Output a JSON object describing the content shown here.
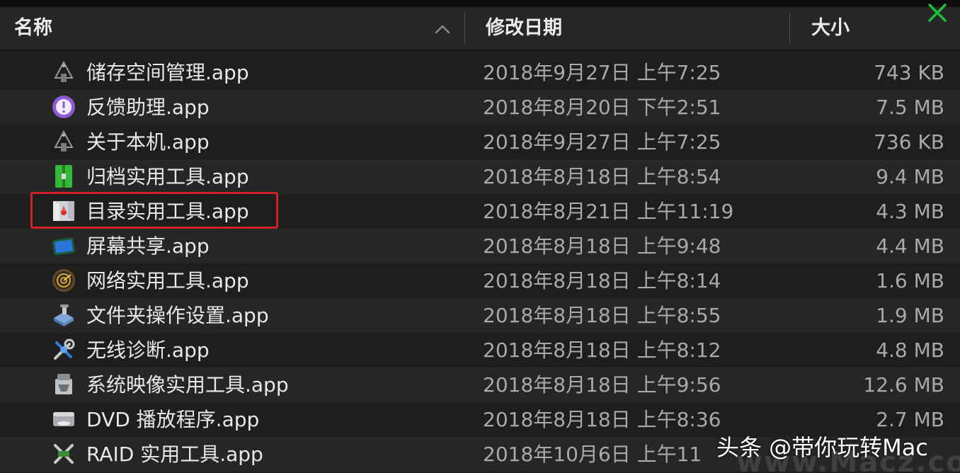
{
  "header": {
    "name_label": "名称",
    "date_label": "修改日期",
    "size_label": "大小",
    "sort_icon": "chevron-up-icon",
    "close_icon": "close-icon"
  },
  "files": [
    {
      "name": "储存空间管理.app",
      "date": "2018年9月27日 上午7:25",
      "size": "743 KB",
      "icon": "storage-management-icon"
    },
    {
      "name": "反馈助理.app",
      "date": "2018年8月20日 下午2:51",
      "size": "7.5 MB",
      "icon": "feedback-assistant-icon"
    },
    {
      "name": "关于本机.app",
      "date": "2018年9月27日 上午7:25",
      "size": "736 KB",
      "icon": "about-this-mac-icon"
    },
    {
      "name": "归档实用工具.app",
      "date": "2018年8月18日 上午8:54",
      "size": "9.4 MB",
      "icon": "archive-utility-icon"
    },
    {
      "name": "目录实用工具.app",
      "date": "2018年8月21日 上午11:19",
      "size": "4.3 MB",
      "icon": "directory-utility-icon"
    },
    {
      "name": "屏幕共享.app",
      "date": "2018年8月18日 上午9:48",
      "size": "4.4 MB",
      "icon": "screen-sharing-icon"
    },
    {
      "name": "网络实用工具.app",
      "date": "2018年8月18日 上午8:14",
      "size": "1.6 MB",
      "icon": "network-utility-icon"
    },
    {
      "name": "文件夹操作设置.app",
      "date": "2018年8月18日 上午8:55",
      "size": "1.9 MB",
      "icon": "folder-actions-icon"
    },
    {
      "name": "无线诊断.app",
      "date": "2018年8月18日 上午8:12",
      "size": "4.8 MB",
      "icon": "wireless-diagnostics-icon"
    },
    {
      "name": "系统映像实用工具.app",
      "date": "2018年8月18日 上午9:56",
      "size": "12.6 MB",
      "icon": "system-image-utility-icon"
    },
    {
      "name": "DVD 播放程序.app",
      "date": "2018年8月18日 上午8:36",
      "size": "2.7 MB",
      "icon": "dvd-player-icon"
    },
    {
      "name": "RAID 实用工具.app",
      "date": "2018年10月6日 上午11",
      "size": "",
      "icon": "raid-utility-icon"
    }
  ],
  "highlight_row": 4,
  "watermark": {
    "text": "头条 @带你玩转Mac",
    "faint": "www.Macz.com"
  },
  "colors": {
    "background": "#1e1e1e",
    "alt_row": "#262626",
    "highlight_border": "#d0202a",
    "close_icon": "#1fbf3a"
  }
}
